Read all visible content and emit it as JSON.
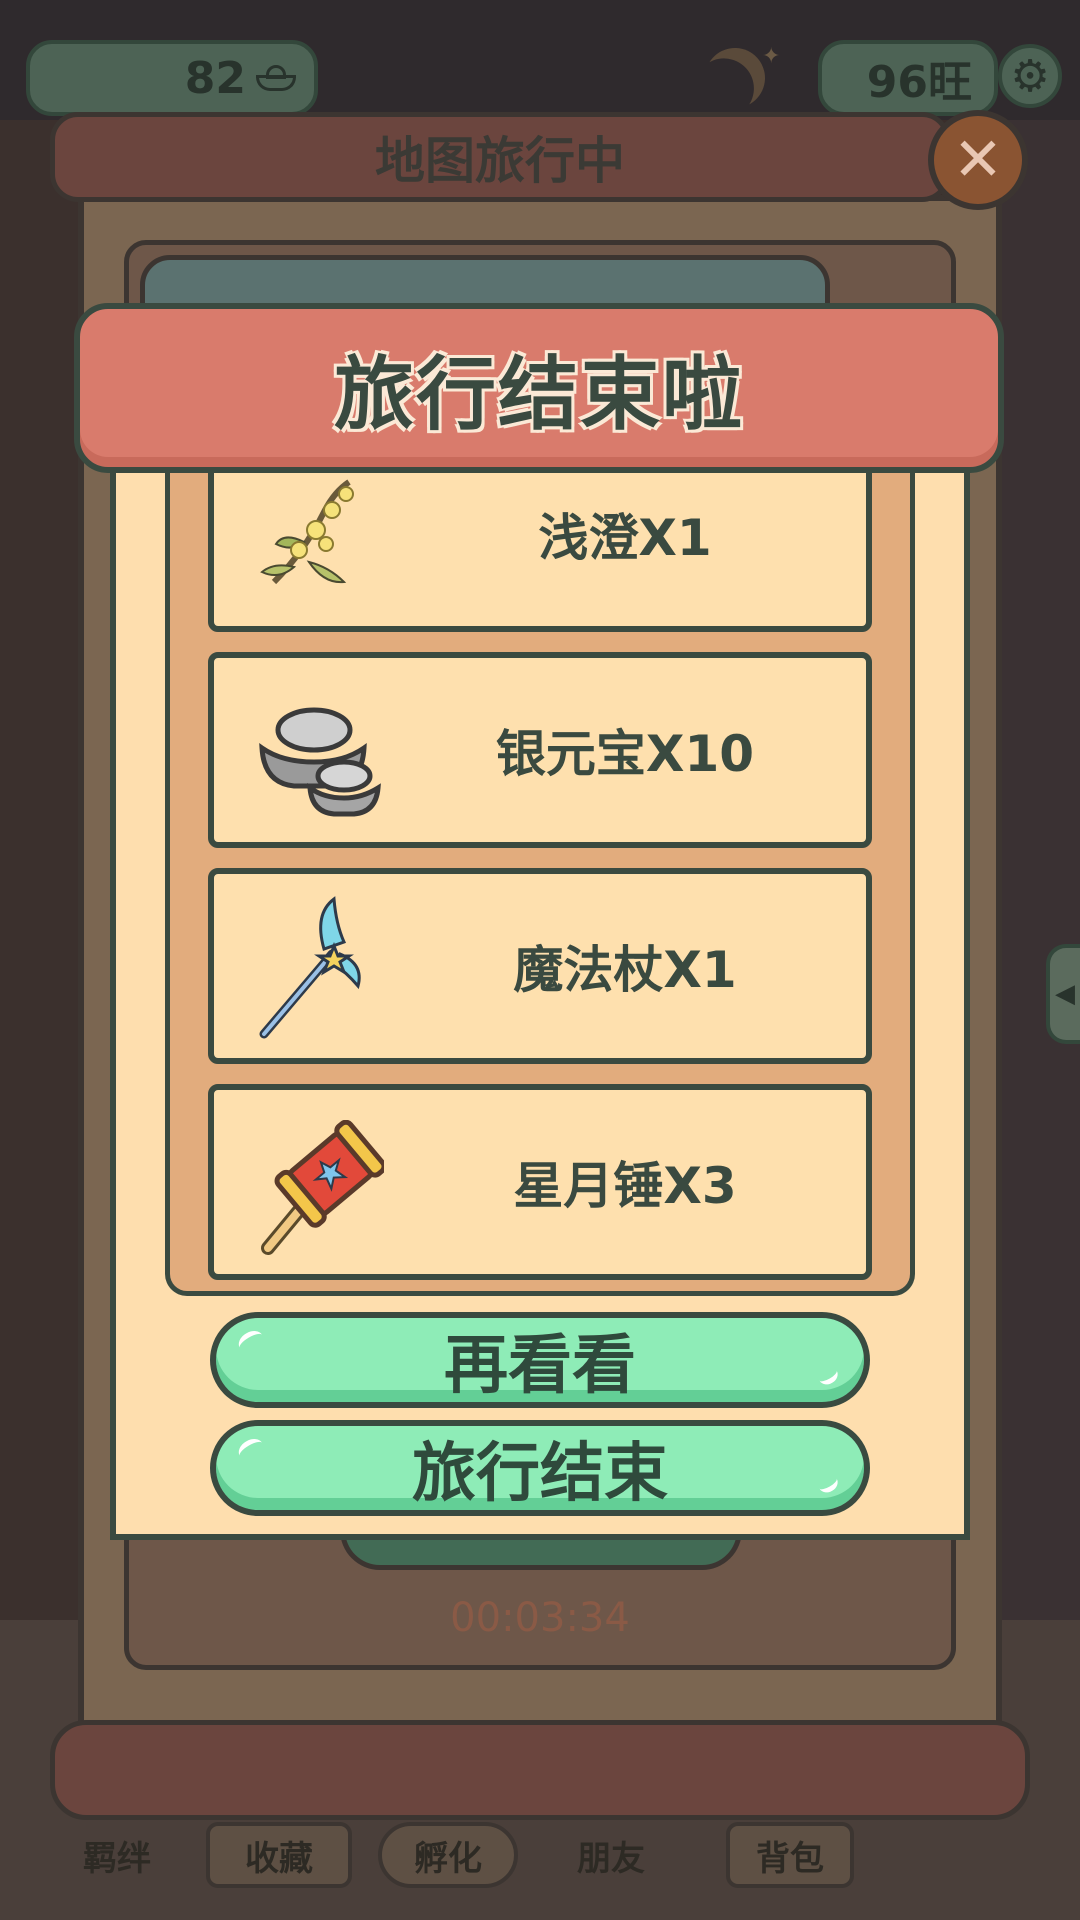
{
  "hud": {
    "coins": "82",
    "wang": "96旺"
  },
  "map_panel": {
    "title": "地图旅行中",
    "timer": "00:03:34"
  },
  "bottom_nav": {
    "items": [
      "羁绊",
      "收藏",
      "孵化",
      "朋友",
      "背包"
    ]
  },
  "dialog": {
    "title": "旅行结束啦",
    "rewards": [
      {
        "label": "浅澄X1",
        "icon": "flower-branch-icon"
      },
      {
        "label": "银元宝X10",
        "icon": "silver-ingot-icon"
      },
      {
        "label": "魔法杖X1",
        "icon": "magic-wand-icon"
      },
      {
        "label": "星月锤X3",
        "icon": "star-hammer-icon"
      }
    ],
    "buttons": {
      "look_again": "再看看",
      "end_travel": "旅行结束"
    }
  },
  "colors": {
    "dialog_header": "#d97b6c",
    "dialog_body": "#fedeae",
    "list_frame": "#e2ac7d",
    "button_green": "#8eecb7",
    "outline": "#3a4a40"
  }
}
